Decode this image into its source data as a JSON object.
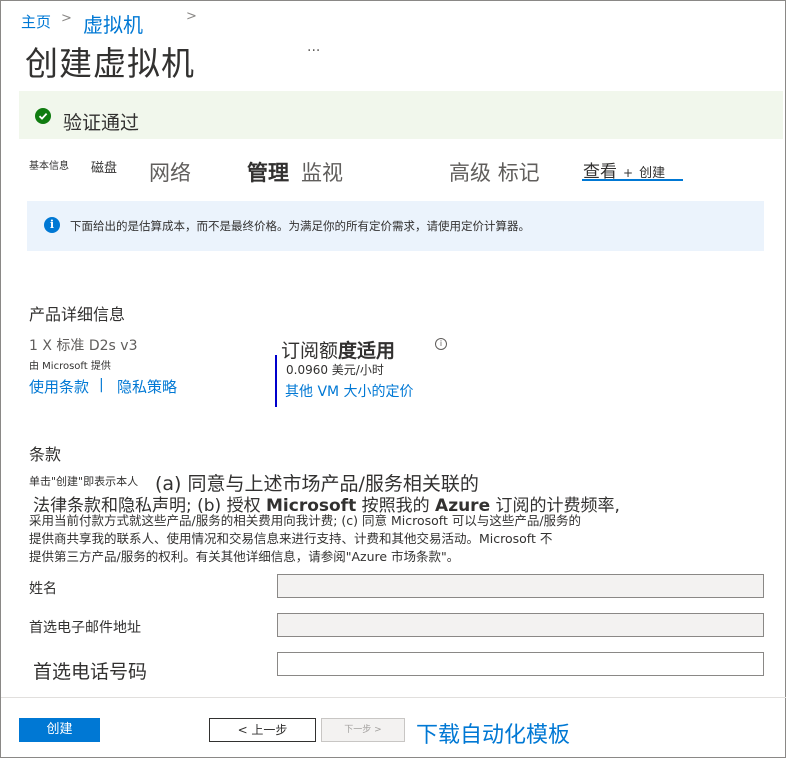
{
  "breadcrumb": {
    "home": "主页",
    "separator": ">",
    "current": "虚拟机",
    "trailing_separator": ">"
  },
  "page": {
    "title": "创建虚拟机",
    "more": "..."
  },
  "validation": {
    "text": "验证通过",
    "color": "#107c10"
  },
  "tabs": {
    "basics": "基本信息",
    "disks": "磁盘",
    "network": "网络",
    "management": "管理",
    "monitoring": "监视",
    "advanced": "高级",
    "tags": "标记",
    "review": "查看",
    "review_plus": "+",
    "review_create": "创建",
    "active": "查看 + 创建"
  },
  "info_banner": {
    "icon": "i",
    "text": "下面给出的是估算成本，而不是最终价格。为满足你的所有定价需求，请使用定价计算器。"
  },
  "product": {
    "heading": "产品详细信息",
    "sku": "1 X  标准 D2s v3",
    "provider": "由 Microsoft 提供",
    "terms_link": "使用条款",
    "link_divider": "|",
    "privacy_link": "隐私策略"
  },
  "pricing": {
    "heading_part1": "订阅额",
    "heading_part2": "度适用",
    "info_icon": "i",
    "value": "0.0960 美元/小时",
    "other_sizes_link": "其他 VM 大小的定价"
  },
  "terms": {
    "heading": "条款",
    "intro": "单击\"创建\"即表示本人",
    "large_line": "(a) 同意与上述市场产品/服务相关联的",
    "line2_a": "法律条款和隐私声明; (b) 授权 ",
    "line2_ms": "Microsoft",
    "line2_b": " 按照我的 ",
    "line2_azure": "Azure",
    "line2_c": " 订阅的计费频率,",
    "line3": "采用当前付款方式就这些产品/服务的相关费用向我计费; (c) 同意 Microsoft 可以与这些产品/服务的",
    "line4": "提供商共享我的联系人、使用情况和交易信息来进行支持、计费和其他交易活动。Microsoft 不",
    "line5": "提供第三方产品/服务的权利。有关其他详细信息，请参阅\"Azure 市场条款\"。"
  },
  "contact": {
    "name_label": "姓名",
    "name_value": "",
    "email_label": "首选电子邮件地址",
    "email_value": "",
    "phone_label": "首选电话号码",
    "phone_value": ""
  },
  "footer": {
    "create": "创建",
    "previous": "< 上一步",
    "next": "下一步 >",
    "download": "下载自动化模板"
  },
  "colors": {
    "accent": "#0078d4",
    "success": "#107c10",
    "validation_bg": "#f1f7ec",
    "info_bg": "#ebf3fc"
  }
}
